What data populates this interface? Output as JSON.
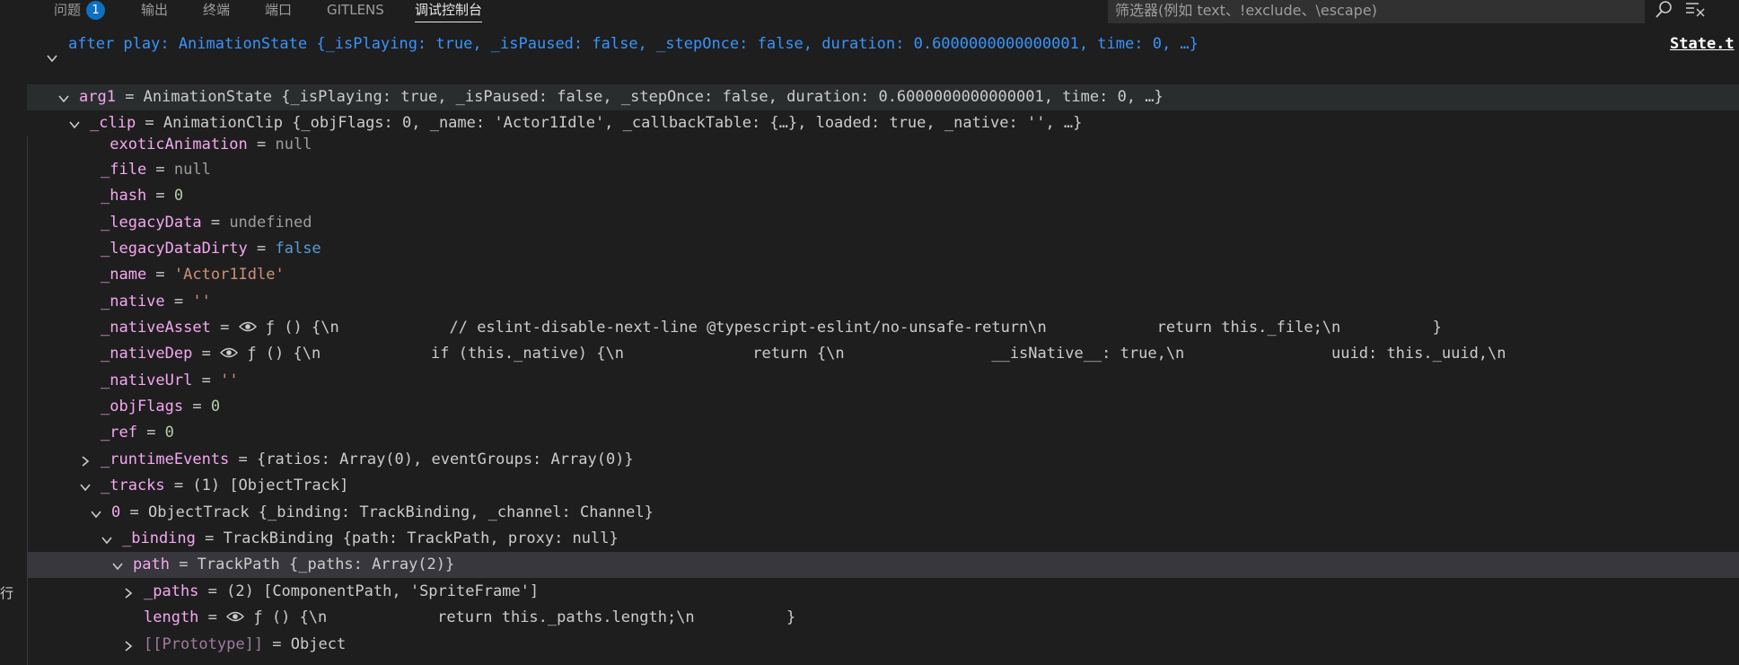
{
  "tabs": [
    {
      "label": "问题",
      "badge": "1",
      "active": false
    },
    {
      "label": "输出",
      "active": false
    },
    {
      "label": "终端",
      "active": false
    },
    {
      "label": "端口",
      "active": false
    },
    {
      "label": "GITLENS",
      "active": false
    },
    {
      "label": "调试控制台",
      "active": true
    }
  ],
  "filter": {
    "placeholder": "筛选器(例如 text、!exclude、\\escape)"
  },
  "toolbar": {
    "search_icon": "search-icon",
    "clear_icon": "clear-console-icon"
  },
  "log_entry": {
    "text": "after play: AnimationState {_isPlaying: true, _isPaused: false, _stepOnce: false, duration: 0.6000000000000001, time: 0, …}",
    "source_link": "State.t"
  },
  "tree": {
    "arg1": {
      "key": "arg1",
      "value": "AnimationState {_isPlaying: true, _isPaused: false, _stepOnce: false, duration: 0.6000000000000001, time: 0, …}"
    },
    "clip": {
      "key": "_clip",
      "value": "AnimationClip {_objFlags: 0, _name: 'Actor1Idle', _callbackTable: {…}, loaded: true, _native: '', …}"
    },
    "exoticAnimation": {
      "key": "_exoticAnimation",
      "value": "null"
    },
    "file": {
      "key": "_file",
      "value": "null"
    },
    "hash": {
      "key": "_hash",
      "value": "0"
    },
    "legacyData": {
      "key": "_legacyData",
      "value": "undefined"
    },
    "legacyDataDirty": {
      "key": "_legacyDataDirty",
      "value": "false"
    },
    "name": {
      "key": "_name",
      "value": "'Actor1Idle'"
    },
    "native": {
      "key": "_native",
      "value": "''"
    },
    "nativeAsset": {
      "key": "_nativeAsset",
      "value": "ƒ () {\\n            // eslint-disable-next-line @typescript-eslint/no-unsafe-return\\n            return this._file;\\n          }"
    },
    "nativeDep": {
      "key": "_nativeDep",
      "value": "ƒ () {\\n            if (this._native) {\\n              return {\\n                __isNative__: true,\\n                uuid: this._uuid,\\n"
    },
    "nativeUrl": {
      "key": "_nativeUrl",
      "value": "''"
    },
    "objFlags": {
      "key": "_objFlags",
      "value": "0"
    },
    "ref": {
      "key": "_ref",
      "value": "0"
    },
    "runtimeEvents": {
      "key": "_runtimeEvents",
      "value": "{ratios: Array(0), eventGroups: Array(0)}"
    },
    "tracks": {
      "key": "_tracks",
      "value": "(1) [ObjectTrack]"
    },
    "track0": {
      "key": "0",
      "value": "ObjectTrack {_binding: TrackBinding, _channel: Channel}"
    },
    "binding": {
      "key": "_binding",
      "value": "TrackBinding {path: TrackPath, proxy: null}"
    },
    "path": {
      "key": "path",
      "value": "TrackPath {_paths: Array(2)}"
    },
    "paths": {
      "key": "_paths",
      "value": "(2) [ComponentPath, 'SpriteFrame']"
    },
    "length": {
      "key": "length",
      "value": "ƒ () {\\n            return this._paths.length;\\n          }"
    },
    "prototype": {
      "key": "[[Prototype]]",
      "value": "Object"
    }
  },
  "edge_text": "行",
  "colors": {
    "background": "#1e1e1e",
    "selected_row": "#37373d",
    "blue_text": "#3794ff",
    "badge": "#0e70c0"
  }
}
